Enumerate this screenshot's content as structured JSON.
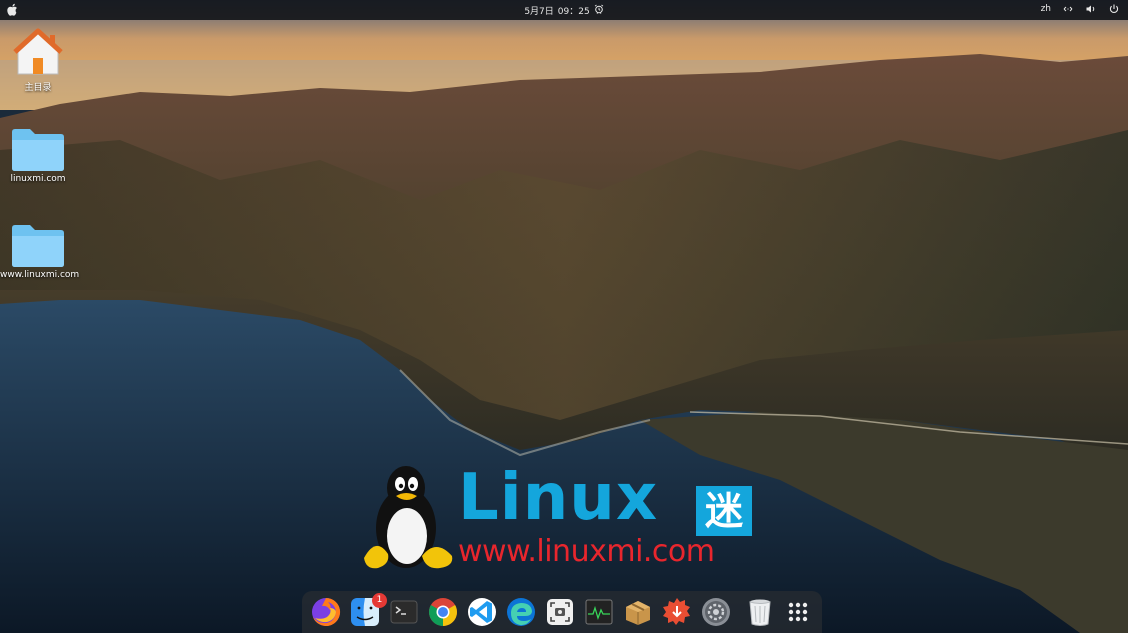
{
  "topbar": {
    "date": "5月7日",
    "time": "09：25",
    "language": "zh",
    "icons": [
      "apple-icon",
      "alarm-clock-icon",
      "network-icon",
      "volume-icon",
      "power-icon"
    ]
  },
  "desktop": {
    "icons": [
      {
        "name": "home-folder",
        "label": "主目录"
      },
      {
        "name": "folder",
        "label": "linuxmi.com"
      },
      {
        "name": "folder",
        "label": "www.linuxmi.com"
      }
    ]
  },
  "watermark": {
    "word": "Linux",
    "mark": "迷",
    "url": "www.linuxmi.com",
    "colors": {
      "blue": "#14a6dc",
      "red": "#e8262d"
    }
  },
  "dock": {
    "apps": [
      {
        "name": "firefox-icon"
      },
      {
        "name": "finder-icon",
        "badge": "1"
      },
      {
        "name": "terminal-icon"
      },
      {
        "name": "chrome-icon"
      },
      {
        "name": "vscode-icon"
      },
      {
        "name": "edge-icon"
      },
      {
        "name": "screenshot-icon"
      },
      {
        "name": "system-monitor-icon"
      },
      {
        "name": "archive-manager-icon"
      },
      {
        "name": "software-updater-icon"
      },
      {
        "name": "settings-icon"
      },
      {
        "name": "trash-icon"
      },
      {
        "name": "app-grid-icon"
      }
    ]
  }
}
